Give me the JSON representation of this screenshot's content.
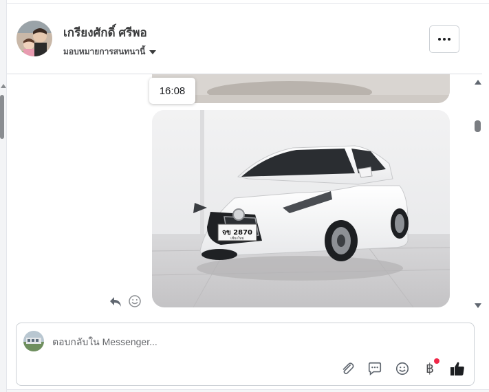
{
  "header": {
    "contact_name": "เกรียงศักดิ์ ศรีพอ",
    "assign_label": "มอบหมายการสนทนานี้"
  },
  "thread": {
    "timestamp": "16:08",
    "plate_text": "จข 2870",
    "plate_province": "เชียงใหม่"
  },
  "composer": {
    "placeholder": "ตอบกลับใน Messenger..."
  },
  "colors": {
    "notification_dot": "#f02849",
    "border": "#ccd0d5"
  },
  "icons": [
    "more-options-icon",
    "reply-icon",
    "react-icon",
    "attach-icon",
    "saved-replies-icon",
    "emoji-icon",
    "payment-icon",
    "like-icon"
  ]
}
